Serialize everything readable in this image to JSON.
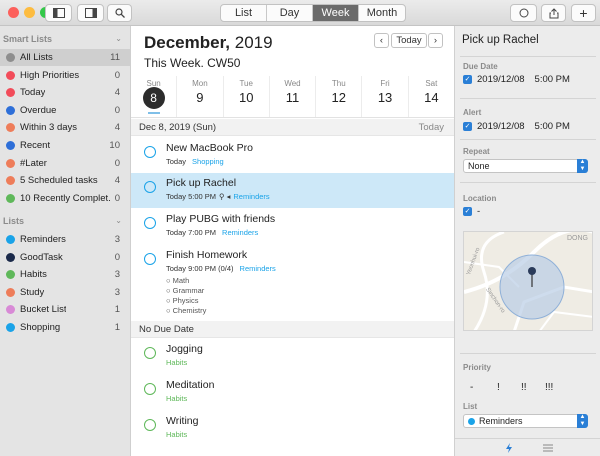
{
  "toolbar": {
    "views": [
      "List",
      "Day",
      "Week",
      "Month"
    ],
    "active_view": "Week",
    "colors": {
      "close": "#fc605c",
      "minimize": "#fdbc40",
      "zoom": "#34c84a"
    }
  },
  "sidebar": {
    "smart_header": "Smart Lists",
    "smart": [
      {
        "label": "All Lists",
        "count": "11",
        "color": "#8e8e8e",
        "selected": true
      },
      {
        "label": "High Priorities",
        "count": "0",
        "color": "#f24c5a"
      },
      {
        "label": "Today",
        "count": "4",
        "color": "#f24c5a"
      },
      {
        "label": "Overdue",
        "count": "0",
        "color": "#2e6fd8"
      },
      {
        "label": "Within 3 days",
        "count": "4",
        "color": "#ee7d5a"
      },
      {
        "label": "Recent",
        "count": "10",
        "color": "#2e6fd8"
      },
      {
        "label": "#Later",
        "count": "0",
        "color": "#ee7d5a"
      },
      {
        "label": "5 Scheduled tasks",
        "count": "4",
        "color": "#ee7d5a"
      },
      {
        "label": "10 Recently Complet...",
        "count": "0",
        "color": "#5fb85a"
      }
    ],
    "lists_header": "Lists",
    "lists": [
      {
        "label": "Reminders",
        "count": "3",
        "color": "#1aa3e8"
      },
      {
        "label": "GoodTask",
        "count": "0",
        "color": "#1b2a4a"
      },
      {
        "label": "Habits",
        "count": "3",
        "color": "#5fb85a"
      },
      {
        "label": "Study",
        "count": "3",
        "color": "#ee7d5a"
      },
      {
        "label": "Bucket List",
        "count": "1",
        "color": "#d88ad6"
      },
      {
        "label": "Shopping",
        "count": "1",
        "color": "#1aa3e8"
      }
    ]
  },
  "main": {
    "month": "December,",
    "year": "2019",
    "week_title": "This Week. CW50",
    "today_button": "Today",
    "prev_icon": "‹",
    "next_icon": "›",
    "days": [
      {
        "name": "Sun",
        "num": "8",
        "today": true
      },
      {
        "name": "Mon",
        "num": "9"
      },
      {
        "name": "Tue",
        "num": "10"
      },
      {
        "name": "Wed",
        "num": "11"
      },
      {
        "name": "Thu",
        "num": "12"
      },
      {
        "name": "Fri",
        "num": "13"
      },
      {
        "name": "Sat",
        "num": "14"
      }
    ],
    "section1": {
      "label": "Dec 8, 2019 (Sun)",
      "right": "Today"
    },
    "section2": {
      "label": "No Due Date"
    },
    "tasks": [
      {
        "title": "New MacBook Pro",
        "time": "Today",
        "list": "Shopping",
        "list_color": "#1aa3e8",
        "circle": "#1aa3e8"
      },
      {
        "title": "Pick up Rachel",
        "time": "Today 5:00 PM",
        "list": "Reminders",
        "list_color": "#1aa3e8",
        "circle": "#1aa3e8",
        "selected": true
      },
      {
        "title": "Play PUBG with friends",
        "time": "Today 7:00 PM",
        "list": "Reminders",
        "list_color": "#1aa3e8",
        "circle": "#1aa3e8"
      },
      {
        "title": "Finish Homework",
        "time": "Today 9:00 PM (0/4)",
        "list": "Reminders",
        "list_color": "#1aa3e8",
        "circle": "#1aa3e8",
        "subtasks": [
          "Math",
          "Grammar",
          "Physics",
          "Chemistry"
        ]
      },
      {
        "title": "Jogging",
        "time": "",
        "list": "Habits",
        "list_color": "#5fb85a",
        "circle": "#5fb85a"
      },
      {
        "title": "Meditation",
        "time": "",
        "list": "Habits",
        "list_color": "#5fb85a",
        "circle": "#5fb85a"
      },
      {
        "title": "Writing",
        "time": "",
        "list": "Habits",
        "list_color": "#5fb85a",
        "circle": "#5fb85a"
      }
    ]
  },
  "detail": {
    "title": "Pick up Rachel",
    "due_label": "Due Date",
    "due_date": "2019/12/08",
    "due_time": "5:00 PM",
    "alert_label": "Alert",
    "alert_date": "2019/12/08",
    "alert_time": "5:00 PM",
    "repeat_label": "Repeat",
    "repeat_value": "None",
    "location_label": "Location",
    "location_value": "-",
    "map_labels": {
      "district": "DONG",
      "street": "Yeonhui-ro",
      "road": "Sinchon-ro"
    },
    "priority_label": "Priority",
    "priorities": [
      "-",
      "!",
      "!!",
      "!!!"
    ],
    "list_label": "List",
    "list_value": "Reminders"
  }
}
